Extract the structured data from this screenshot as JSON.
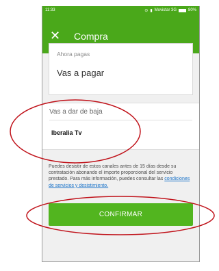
{
  "status_bar": {
    "time": "11:33",
    "carrier": "Movistar 3G",
    "battery": "80%"
  },
  "app_bar": {
    "close_icon": "close-icon",
    "title": "Compra"
  },
  "payment_card": {
    "label": "Ahora pagas",
    "value": "Vas a pagar"
  },
  "cancel_section": {
    "title": "Vas a dar de baja",
    "channel": "Iberalia Tv"
  },
  "legal": {
    "text": "Puedes desistir de estos canales antes de 15 días desde su contratación abonando el importe proporcional del servicio prestado. Para más información, puedes consultar las ",
    "link": "condiciones de servicios y desistimiento."
  },
  "confirm_button": {
    "label": "CONFIRMAR"
  },
  "colors": {
    "brand_green": "#4aa81a",
    "button_green": "#52b51f",
    "annotation_red": "#c0121a",
    "link_blue": "#1a73c9"
  }
}
